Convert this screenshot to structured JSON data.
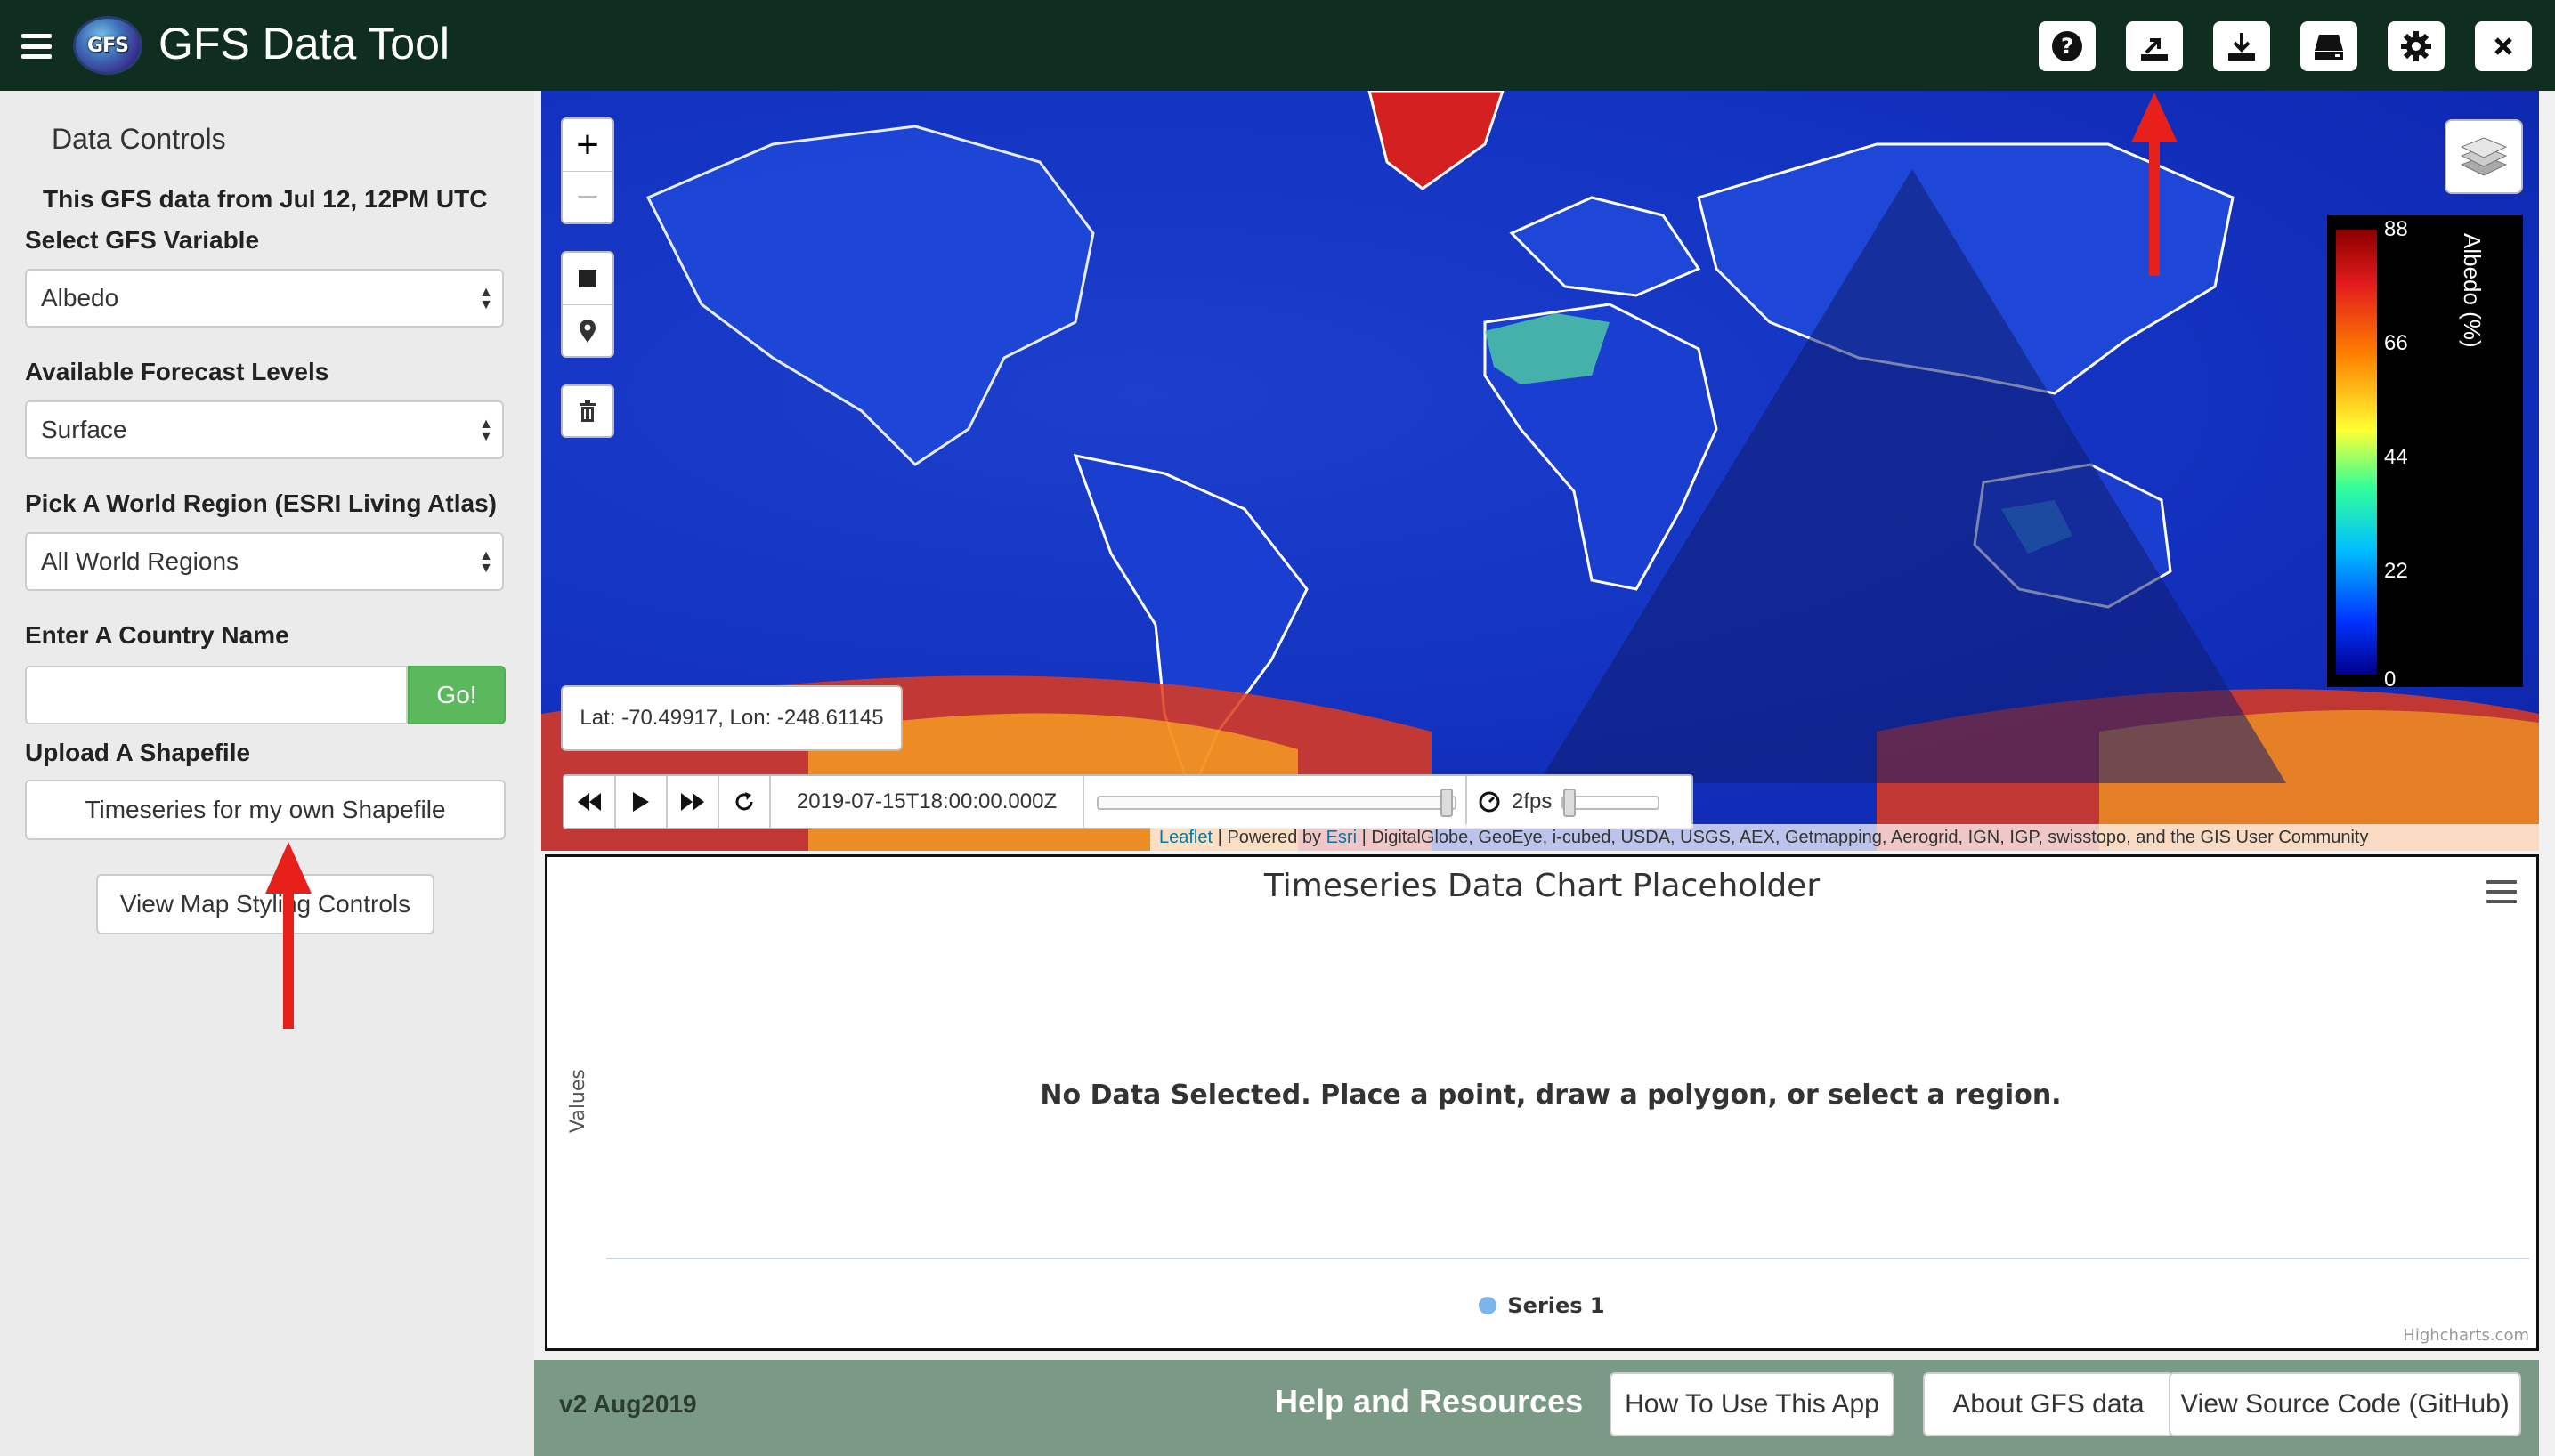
{
  "app": {
    "title": "GFS Data Tool",
    "logo_text": "GFS"
  },
  "toolbar": {
    "icons": [
      "help-icon",
      "upload-icon",
      "download-icon",
      "drive-icon",
      "gear-icon",
      "close-icon"
    ]
  },
  "sidebar": {
    "heading": "Data Controls",
    "data_note": "This GFS data from Jul 12, 12PM UTC",
    "variable_label": "Select GFS Variable",
    "variable_value": "Albedo",
    "levels_label": "Available Forecast Levels",
    "levels_value": "Surface",
    "region_label": "Pick A World Region (ESRI Living Atlas)",
    "region_value": "All World Regions",
    "country_label": "Enter A Country Name",
    "country_value": "",
    "go_label": "Go!",
    "shapefile_label": "Upload A Shapefile",
    "shapefile_button": "Timeseries for my own Shapefile",
    "styling_button": "View Map Styling Controls"
  },
  "map": {
    "zoom_in": "+",
    "zoom_out": "−",
    "coords_readout": "Lat: -70.49917, Lon: -248.61145",
    "legend": {
      "title": "Albedo (%)",
      "ticks": [
        "88",
        "66",
        "44",
        "22",
        "0"
      ]
    },
    "player": {
      "time": "2019-07-15T18:00:00.000Z",
      "fps": "2fps"
    },
    "attribution": {
      "leaflet": "Leaflet",
      "powered_by": "Powered by",
      "esri": "Esri",
      "sources": "DigitalGlobe, GeoEye, i-cubed, USDA, USGS, AEX, Getmapping, Aerogrid, IGN, IGP, swisstopo, and the GIS User Community"
    }
  },
  "chart": {
    "title": "Timeseries Data Chart Placeholder",
    "y_label": "Values",
    "no_data": "No Data Selected. Place a point, draw a polygon, or select a region.",
    "legend_series": "Series 1",
    "credits": "Highcharts.com"
  },
  "footer": {
    "version": "v2 Aug2019",
    "help_title": "Help and Resources",
    "buttons": [
      "How To Use This App",
      "About GFS data",
      "View Source Code (GitHub)"
    ]
  },
  "colors": {
    "topbar": "#0f2e1f",
    "go_button": "#5cb85c",
    "footer": "#7a9a86",
    "annotation_arrow": "#e8201c",
    "series": "#7cb5ec"
  }
}
